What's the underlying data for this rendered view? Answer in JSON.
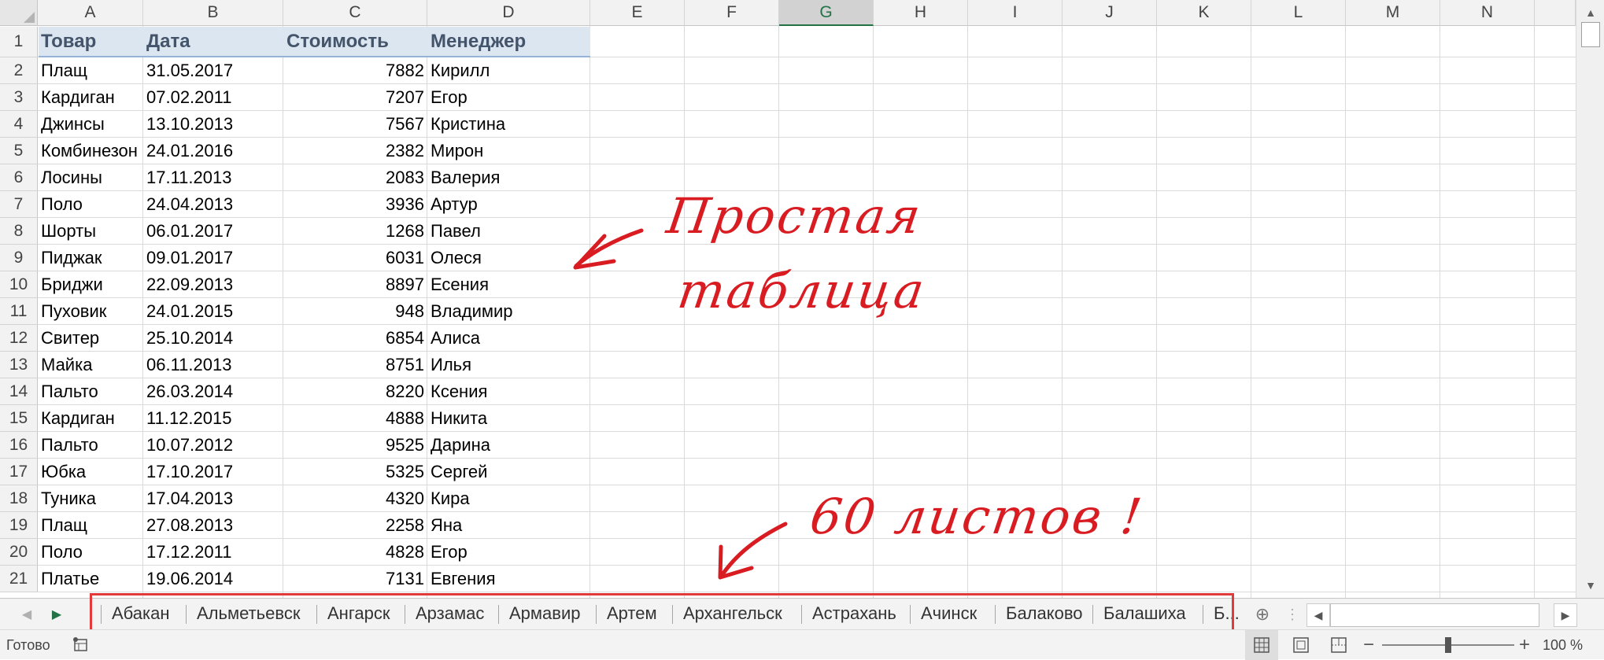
{
  "columns": [
    "A",
    "B",
    "C",
    "D",
    "E",
    "F",
    "G",
    "H",
    "I",
    "J",
    "K",
    "L",
    "M",
    "N"
  ],
  "selected_column": "G",
  "row_numbers": [
    "1",
    "2",
    "3",
    "4",
    "5",
    "6",
    "7",
    "8",
    "9",
    "10",
    "11",
    "12",
    "13",
    "14",
    "15",
    "16",
    "17",
    "18",
    "19",
    "20",
    "21"
  ],
  "table": {
    "headers": [
      "Товар",
      "Дата",
      "Стоимость",
      "Менеджер"
    ],
    "rows": [
      [
        "Плащ",
        "31.05.2017",
        "7882",
        "Кирилл"
      ],
      [
        "Кардиган",
        "07.02.2011",
        "7207",
        "Егор"
      ],
      [
        "Джинсы",
        "13.10.2013",
        "7567",
        "Кристина"
      ],
      [
        "Комбинезон",
        "24.01.2016",
        "2382",
        "Мирон"
      ],
      [
        "Лосины",
        "17.11.2013",
        "2083",
        "Валерия"
      ],
      [
        "Поло",
        "24.04.2013",
        "3936",
        "Артур"
      ],
      [
        "Шорты",
        "06.01.2017",
        "1268",
        "Павел"
      ],
      [
        "Пиджак",
        "09.01.2017",
        "6031",
        "Олеся"
      ],
      [
        "Бриджи",
        "22.09.2013",
        "8897",
        "Есения"
      ],
      [
        "Пуховик",
        "24.01.2015",
        "948",
        "Владимир"
      ],
      [
        "Свитер",
        "25.10.2014",
        "6854",
        "Алиса"
      ],
      [
        "Майка",
        "06.11.2013",
        "8751",
        "Илья"
      ],
      [
        "Пальто",
        "26.03.2014",
        "8220",
        "Ксения"
      ],
      [
        "Кардиган",
        "11.12.2015",
        "4888",
        "Никита"
      ],
      [
        "Пальто",
        "10.07.2012",
        "9525",
        "Дарина"
      ],
      [
        "Юбка",
        "17.10.2017",
        "5325",
        "Сергей"
      ],
      [
        "Туника",
        "17.04.2013",
        "4320",
        "Кира"
      ],
      [
        "Плащ",
        "27.08.2013",
        "2258",
        "Яна"
      ],
      [
        "Поло",
        "17.12.2011",
        "4828",
        "Егор"
      ],
      [
        "Платье",
        "19.06.2014",
        "7131",
        "Евгения"
      ]
    ]
  },
  "annotations": {
    "line1": "Простая",
    "line2": "таблица",
    "line3": "60 листов !"
  },
  "sheet_tabs": [
    "Абакан",
    "Альметьевск",
    "Ангарск",
    "Арзамас",
    "Армавир",
    "Артем",
    "Архангельск",
    "Астрахань",
    "Ачинск",
    "Балаково",
    "Балашиха",
    "Б..."
  ],
  "icons": {
    "prev": "chevron-left-icon",
    "next": "chevron-right-icon",
    "add_sheet": "add-sheet-icon",
    "macro": "macro-record-icon",
    "normal_view": "normal-view-icon",
    "page_layout": "page-layout-icon",
    "page_break": "page-break-icon"
  },
  "status": {
    "ready": "Готово",
    "zoom": "100 %",
    "zoom_level": 100
  },
  "colors": {
    "accent": "#217346",
    "annotation": "#d81c22",
    "header_fill": "#dce6f1",
    "header_text": "#44546a"
  }
}
